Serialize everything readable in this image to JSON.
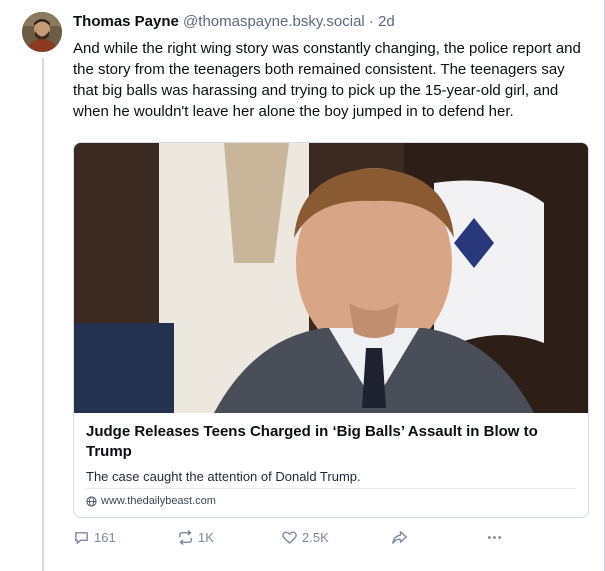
{
  "author": {
    "name": "Thomas Payne",
    "handle": "@thomaspayne.bsky.social",
    "separator": "·",
    "time": "2d"
  },
  "post": {
    "text": "And while the right wing story was constantly changing, the police report and the story from the teenagers both remained consistent. The teenagers say that big balls was harassing and trying to pick up the 15-year-old girl, and when he wouldn't leave her alone the boy jumped in to defend her."
  },
  "embed": {
    "title": "Judge Releases Teens Charged in ‘Big Balls’ Assault in Blow to Trump",
    "description": "The case caught the attention of Donald Trump.",
    "domain": "www.thedailybeast.com"
  },
  "actions": {
    "replies": "161",
    "reposts": "1K",
    "likes": "2.5K"
  },
  "icons": [
    "avatar",
    "globe-icon",
    "reply-icon",
    "repost-icon",
    "like-icon",
    "share-icon",
    "more-icon"
  ],
  "colors": {
    "muted": "#7c8b9c",
    "border": "#d4dbe2",
    "text": "#0b0f14"
  }
}
